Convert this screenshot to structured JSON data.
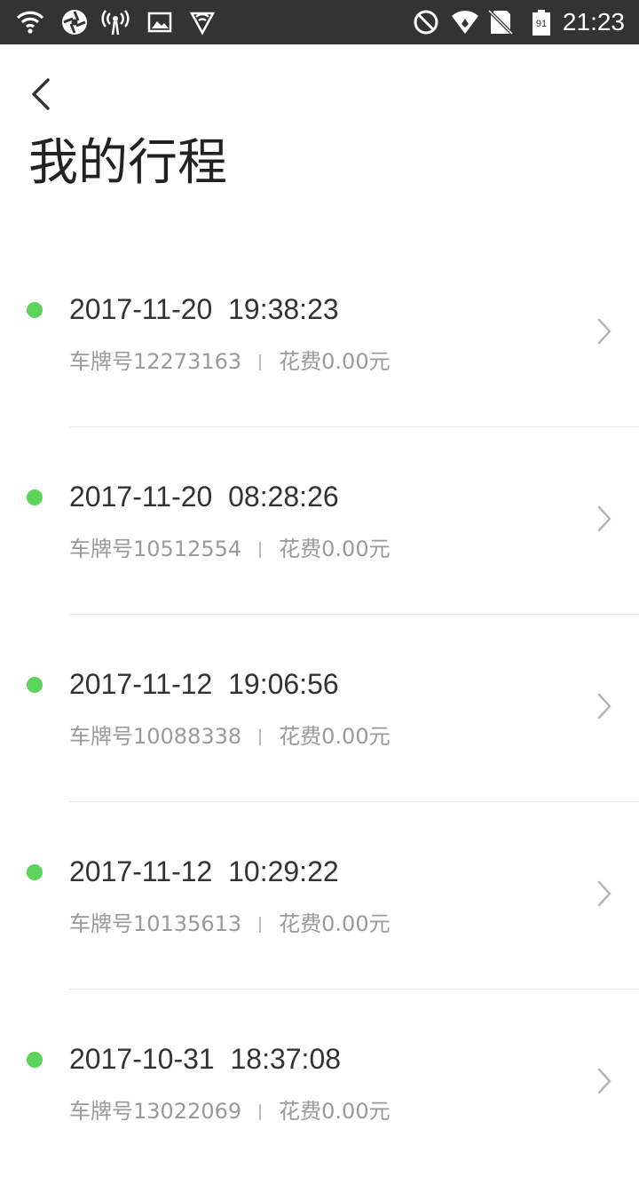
{
  "status_bar": {
    "time": "21:23",
    "battery_level": "91",
    "icons": [
      "wifi-icon",
      "aperture-icon",
      "hotspot-icon",
      "image-icon",
      "shield-icon",
      "do-not-disturb-icon",
      "signal-icon",
      "no-sim-icon",
      "battery-icon"
    ]
  },
  "header": {
    "back_icon": "chevron-left-icon",
    "title": "我的行程"
  },
  "trips": [
    {
      "datetime": "2017-11-20  19:38:23",
      "plate": "车牌号12273163",
      "cost": "花费0.00元"
    },
    {
      "datetime": "2017-11-20  08:28:26",
      "plate": "车牌号10512554",
      "cost": "花费0.00元"
    },
    {
      "datetime": "2017-11-12  19:06:56",
      "plate": "车牌号10088338",
      "cost": "花费0.00元"
    },
    {
      "datetime": "2017-11-12  10:29:22",
      "plate": "车牌号10135613",
      "cost": "花费0.00元"
    },
    {
      "datetime": "2017-10-31  18:37:08",
      "plate": "车牌号13022069",
      "cost": "花费0.00元"
    }
  ],
  "colors": {
    "status_bar_bg": "#333333",
    "dot_green": "#5bd45b",
    "primary_text": "#333333",
    "secondary_text": "#9a9a9a",
    "divider": "#e6e6e6"
  }
}
